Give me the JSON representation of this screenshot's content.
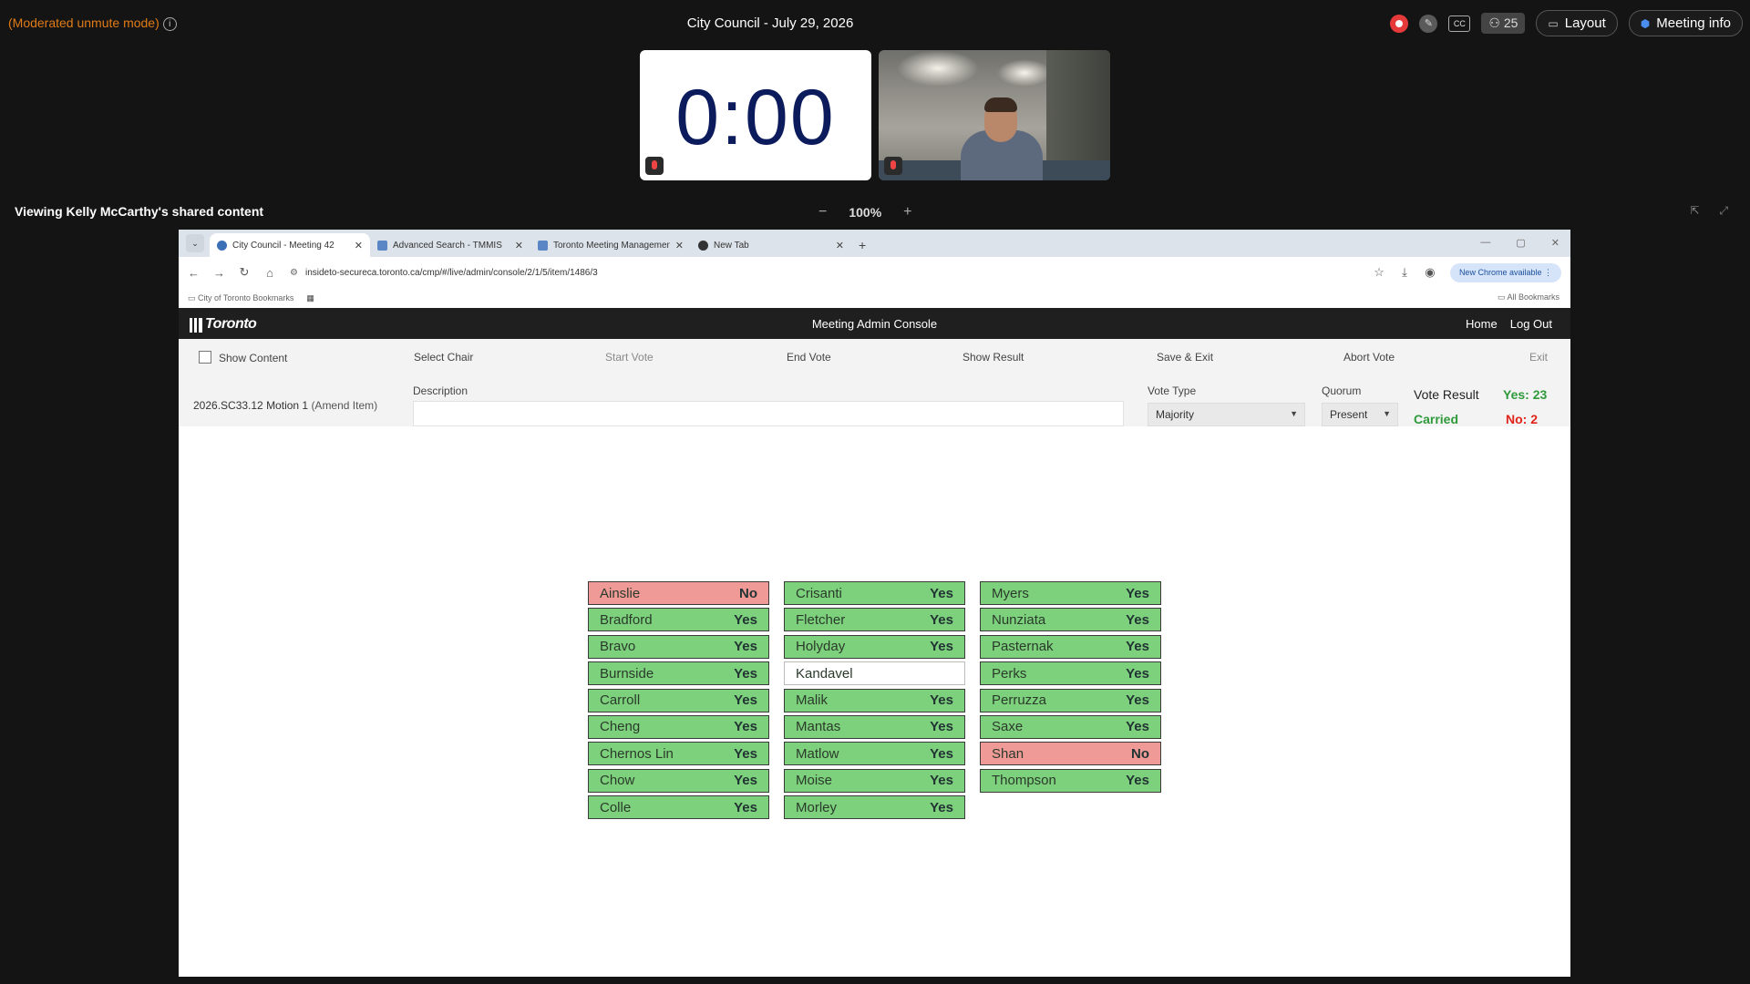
{
  "meeting": {
    "mode_text": "(Moderated unmute mode)",
    "title": "City Council - July 29, 2026",
    "participant_count": "25",
    "layout_label": "Layout",
    "meeting_info_label": "Meeting info",
    "timer": "0:00",
    "share_label": "Viewing Kelly McCarthy's shared content",
    "zoom_level": "100%"
  },
  "browser": {
    "tabs": [
      {
        "label": "City Council - Meeting 42"
      },
      {
        "label": "Advanced Search - TMMIS"
      },
      {
        "label": "Toronto Meeting Management"
      },
      {
        "label": "New Tab"
      }
    ],
    "url": "insideto-secureca.toronto.ca/cmp/#/live/admin/console/2/1/5/item/1486/3",
    "update_label": "New Chrome available",
    "bookmarks_folder": "City of Toronto Bookmarks",
    "all_bookmarks": "All Bookmarks"
  },
  "app": {
    "logo": "Toronto",
    "console_title": "Meeting Admin Console",
    "home_link": "Home",
    "logout_link": "Log Out",
    "toolbar": {
      "show_content": "Show Content",
      "select_chair": "Select Chair",
      "start_vote": "Start Vote",
      "end_vote": "End Vote",
      "show_result": "Show Result",
      "save_exit": "Save & Exit",
      "abort_vote": "Abort Vote",
      "exit": "Exit"
    },
    "motion_id": "2026.SC33.12 Motion 1",
    "motion_type": "(Amend Item)",
    "description_label": "Description",
    "description_value": "",
    "vote_type_label": "Vote Type",
    "vote_type_value": "Majority",
    "quorum_label": "Quorum",
    "quorum_value": "Present",
    "vote_result_label": "Vote Result",
    "vote_result_status": "Carried",
    "yes_count": "Yes: 23",
    "no_count": "No: 2"
  },
  "votes": {
    "col1": [
      {
        "name": "Ainslie",
        "vote": "No"
      },
      {
        "name": "Bradford",
        "vote": "Yes"
      },
      {
        "name": "Bravo",
        "vote": "Yes"
      },
      {
        "name": "Burnside",
        "vote": "Yes"
      },
      {
        "name": "Carroll",
        "vote": "Yes"
      },
      {
        "name": "Cheng",
        "vote": "Yes"
      },
      {
        "name": "Chernos Lin",
        "vote": "Yes"
      },
      {
        "name": "Chow",
        "vote": "Yes"
      },
      {
        "name": "Colle",
        "vote": "Yes"
      }
    ],
    "col2": [
      {
        "name": "Crisanti",
        "vote": "Yes"
      },
      {
        "name": "Fletcher",
        "vote": "Yes"
      },
      {
        "name": "Holyday",
        "vote": "Yes"
      },
      {
        "name": "Kandavel",
        "vote": ""
      },
      {
        "name": "Malik",
        "vote": "Yes"
      },
      {
        "name": "Mantas",
        "vote": "Yes"
      },
      {
        "name": "Matlow",
        "vote": "Yes"
      },
      {
        "name": "Moise",
        "vote": "Yes"
      },
      {
        "name": "Morley",
        "vote": "Yes"
      }
    ],
    "col3": [
      {
        "name": "Myers",
        "vote": "Yes"
      },
      {
        "name": "Nunziata",
        "vote": "Yes"
      },
      {
        "name": "Pasternak",
        "vote": "Yes"
      },
      {
        "name": "Perks",
        "vote": "Yes"
      },
      {
        "name": "Perruzza",
        "vote": "Yes"
      },
      {
        "name": "Saxe",
        "vote": "Yes"
      },
      {
        "name": "Shan",
        "vote": "No"
      },
      {
        "name": "Thompson",
        "vote": "Yes"
      }
    ]
  },
  "colors": {
    "yes": "#7dd17d",
    "no": "#ef9a97",
    "accent_orange": "#e07b16",
    "record_red": "#e5393a"
  }
}
